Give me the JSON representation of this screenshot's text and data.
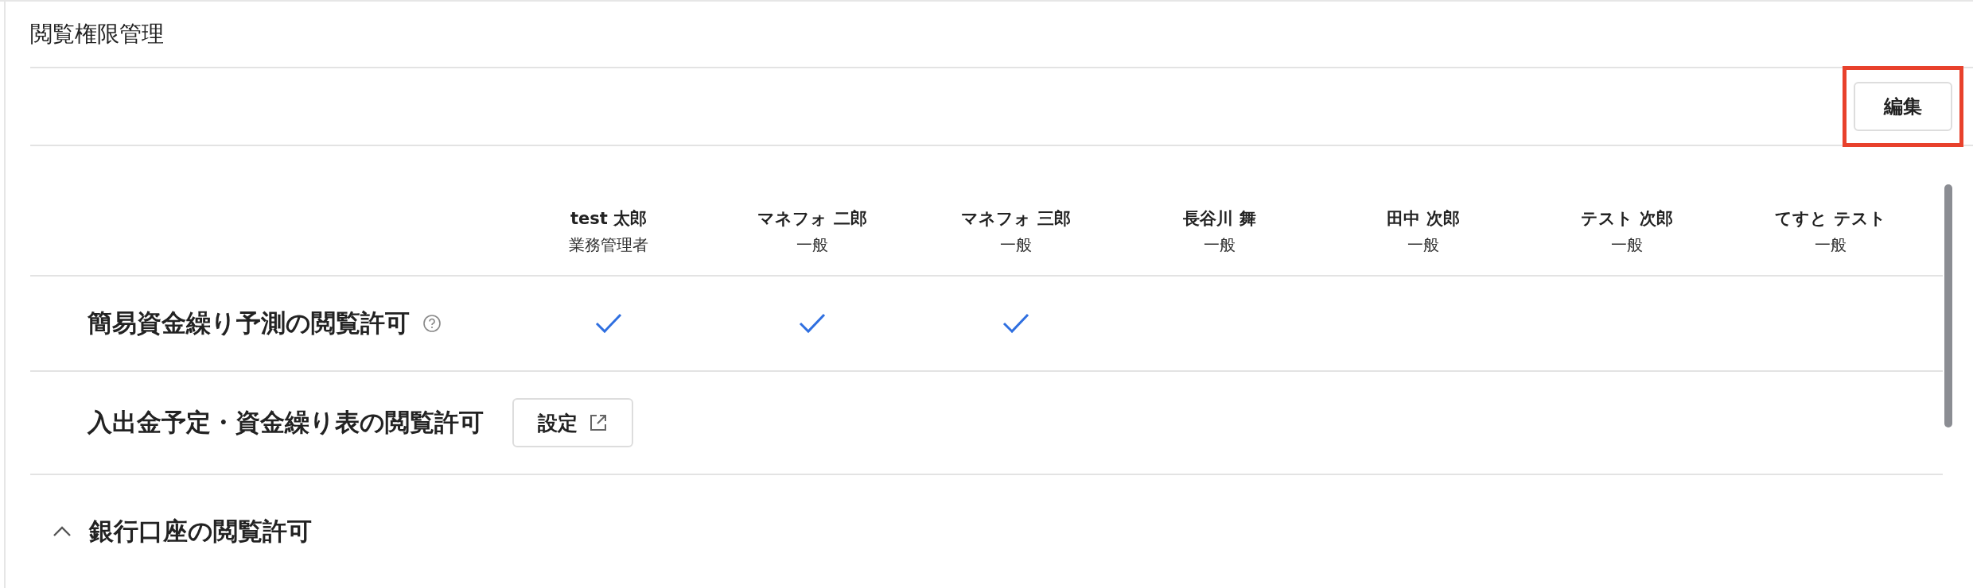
{
  "title": "閲覧権限管理",
  "edit_button": {
    "label": "編集",
    "highlighted": true
  },
  "users": [
    {
      "name": "test 太郎",
      "role": "業務管理者"
    },
    {
      "name": "マネフォ 二郎",
      "role": "一般"
    },
    {
      "name": "マネフォ 三郎",
      "role": "一般"
    },
    {
      "name": "長谷川 舞",
      "role": "一般"
    },
    {
      "name": "田中 次郎",
      "role": "一般"
    },
    {
      "name": "テスト 次郎",
      "role": "一般"
    },
    {
      "name": "てすと テスト",
      "role": "一般"
    }
  ],
  "rows": [
    {
      "kind": "checks",
      "label": "簡易資金繰り予測の閲覧許可",
      "help": true,
      "checked": [
        true,
        true,
        true,
        false,
        false,
        false,
        false
      ]
    },
    {
      "kind": "link",
      "label": "入出金予定・資金繰り表の閲覧許可",
      "button": "設定"
    },
    {
      "kind": "section",
      "label": "銀行口座の閲覧許可",
      "expanded": true
    }
  ]
}
